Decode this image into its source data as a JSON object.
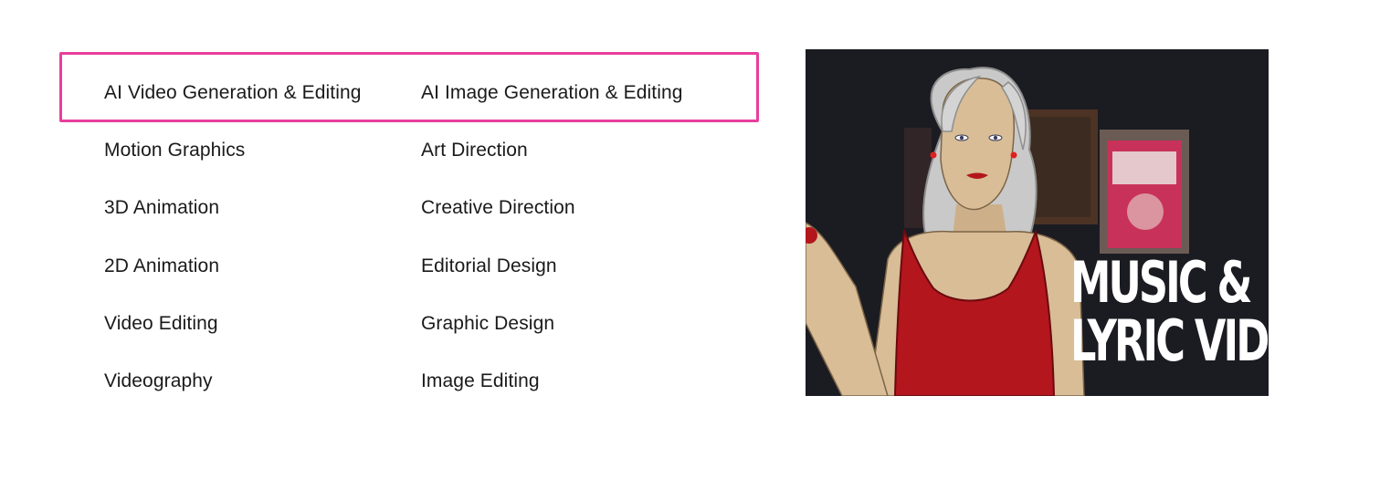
{
  "services": {
    "highlighted_row": [
      {
        "label": "AI Video Generation & Editing"
      },
      {
        "label": "AI Image Generation & Editing"
      }
    ],
    "left_column": [
      {
        "label": "AI Video Generation & Editing"
      },
      {
        "label": "Motion Graphics"
      },
      {
        "label": "3D Animation"
      },
      {
        "label": "2D Animation"
      },
      {
        "label": "Video Editing"
      },
      {
        "label": "Videography"
      }
    ],
    "right_column": [
      {
        "label": "AI Image Generation & Editing"
      },
      {
        "label": "Art Direction"
      },
      {
        "label": "Creative Direction"
      },
      {
        "label": "Editorial Design"
      },
      {
        "label": "Graphic Design"
      },
      {
        "label": "Image Editing"
      }
    ],
    "highlight_color": "#e83e9c"
  },
  "thumbnail": {
    "title_line1": "MUSIC &",
    "title_line2": "LYRIC VIDE",
    "colors": {
      "background": "#1b1b22",
      "hair": "#c9c9c9",
      "skin": "#d8bd97",
      "top": "#b3161c",
      "poster": "#c8325a"
    }
  }
}
